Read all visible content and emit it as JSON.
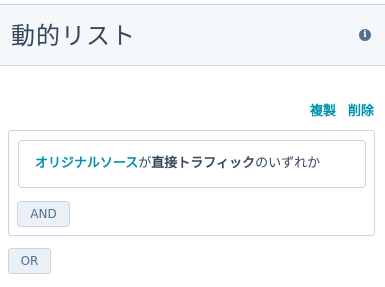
{
  "header": {
    "title": "動的リスト",
    "info_icon_glyph": "i"
  },
  "actions": {
    "clone_label": "複製",
    "delete_label": "削除"
  },
  "filter": {
    "property": "オリジナルソース",
    "particle": "が",
    "value": "直接トラフィック",
    "suffix": "のいずれか"
  },
  "buttons": {
    "and_label": "AND",
    "or_label": "OR"
  },
  "colors": {
    "link": "#0091ae",
    "text": "#33475b",
    "border": "#cbd6e2",
    "header_bg": "#f5f8fa",
    "button_bg": "#eaf0f6"
  },
  "icons": {
    "info": "info-icon"
  }
}
